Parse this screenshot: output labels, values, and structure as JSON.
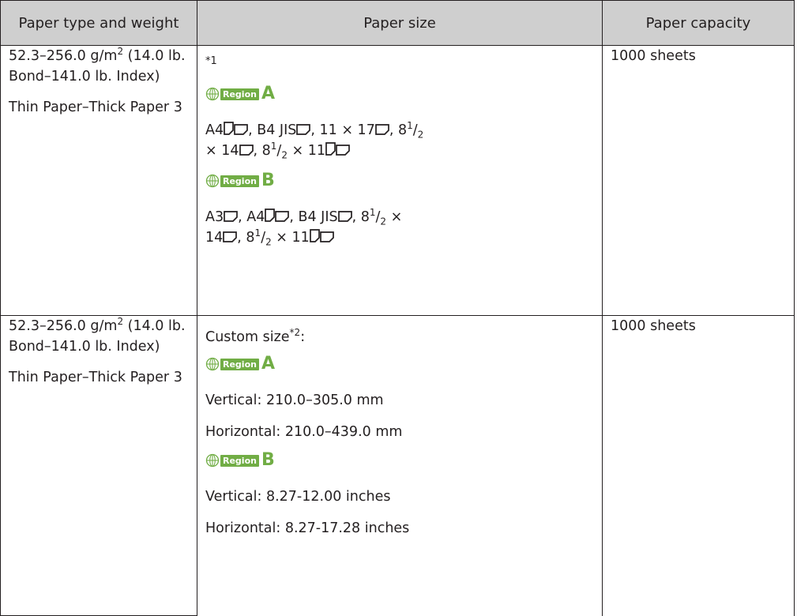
{
  "headers": {
    "type": "Paper type and weight",
    "size": "Paper size",
    "capacity": "Paper capacity"
  },
  "row1": {
    "weight_a": "52.3–256.0 g/m",
    "weight_sup": "2",
    "weight_b": " (14.0 lb.",
    "weight_c": "Bond–141.0 lb. Index)",
    "thickness": "Thin Paper–Thick Paper 3",
    "footnote": "*1",
    "regionA_label": "Region",
    "regionA_letter": "A",
    "a_l1_p1": "A4",
    "a_l1_p2": ", B4 JIS",
    "a_l1_p3": ", 11 × 17",
    "a_l1_p4": ", 8",
    "a_l1_sup": "1",
    "a_l1_slash": "/",
    "a_l1_sub": "2",
    "a_l2_p1": "× 14",
    "a_l2_p2": ", 8",
    "a_l2_sup": "1",
    "a_l2_slash": "/",
    "a_l2_sub": "2",
    "a_l2_p3": " × 11",
    "regionB_label": "Region",
    "regionB_letter": "B",
    "b_l1_p1": "A3",
    "b_l1_p2": ", A4",
    "b_l1_p3": ", B4 JIS",
    "b_l1_p4": ", 8",
    "b_l1_sup": "1",
    "b_l1_slash": "/",
    "b_l1_sub": "2",
    "b_l1_p5": " ×",
    "b_l2_p1": "14",
    "b_l2_p2": ", 8",
    "b_l2_sup": "1",
    "b_l2_slash": "/",
    "b_l2_sub": "2",
    "b_l2_p3": " × 11",
    "capacity": "1000 sheets"
  },
  "row2": {
    "weight_a": "52.3–256.0 g/m",
    "weight_sup": "2",
    "weight_b": " (14.0 lb.",
    "weight_c": "Bond–141.0 lb. Index)",
    "thickness": "Thin Paper–Thick Paper 3",
    "custom_label": "Custom size",
    "custom_sup": "*2",
    "custom_colon": ":",
    "regionA_label": "Region",
    "regionA_letter": "A",
    "a_vertical": "Vertical: 210.0–305.0 mm",
    "a_horizontal": "Horizontal: 210.0–439.0 mm",
    "regionB_label": "Region",
    "regionB_letter": "B",
    "b_vertical": "Vertical: 8.27-12.00 inches",
    "b_horizontal": "Horizontal: 8.27-17.28 inches",
    "capacity": "1000 sheets"
  },
  "colors": {
    "region_green": "#71ad45",
    "header_bg": "#cfcfcf",
    "border": "#231f20"
  },
  "icons": [
    "globe-icon",
    "portrait-orientation-icon",
    "landscape-orientation-icon"
  ]
}
